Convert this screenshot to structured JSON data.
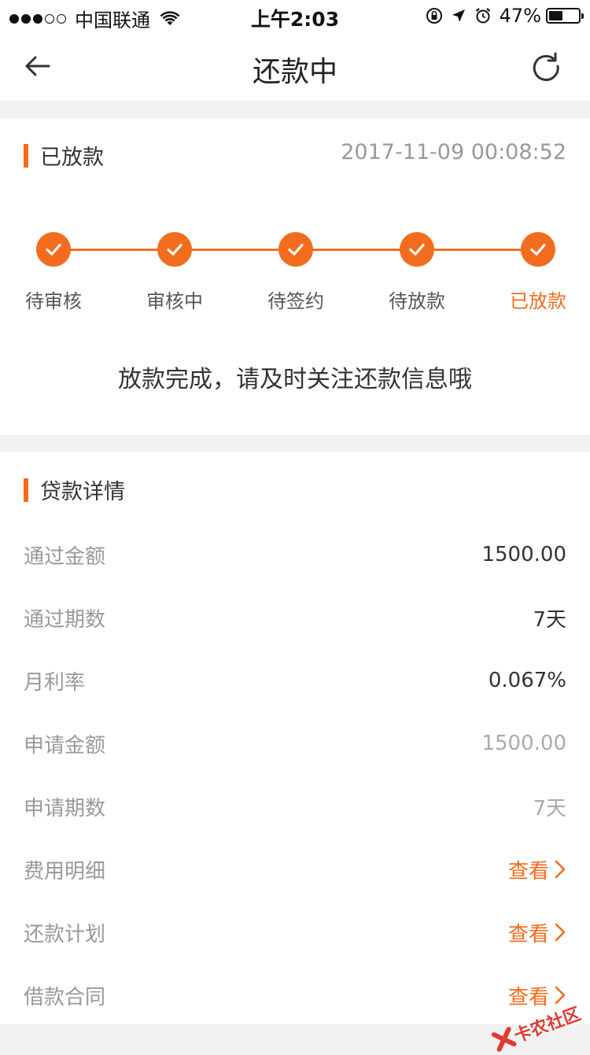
{
  "status_bar": {
    "carrier": "中国联通",
    "time": "上午2:03",
    "battery": "47%",
    "battery_level": 0.47
  },
  "nav": {
    "title": "还款中",
    "back_icon": "arrow-left-icon",
    "refresh_icon": "refresh-icon"
  },
  "status_card": {
    "title": "已放款",
    "timestamp": "2017-11-09 00:08:52",
    "steps": [
      {
        "label": "待审核",
        "active": false
      },
      {
        "label": "审核中",
        "active": false
      },
      {
        "label": "待签约",
        "active": false
      },
      {
        "label": "待放款",
        "active": false
      },
      {
        "label": "已放款",
        "active": true
      }
    ],
    "message": "放款完成，请及时关注还款信息哦"
  },
  "loan_detail": {
    "title": "贷款详情",
    "rows": [
      {
        "label": "通过金额",
        "value": "1500.00"
      },
      {
        "label": "通过期数",
        "value": "7天"
      },
      {
        "label": "月利率",
        "value": "0.067%"
      },
      {
        "label": "申请金额",
        "value": "1500.00"
      },
      {
        "label": "申请期数",
        "value": "7天"
      },
      {
        "label": "费用明细",
        "value": "查看"
      },
      {
        "label": "还款计划",
        "value": "查看"
      },
      {
        "label": "借款合同",
        "value": "查看"
      }
    ]
  },
  "watermark": {
    "text": "卡农社区"
  },
  "colors": {
    "accent": "#f26c1e",
    "muted_text": "#999999",
    "page_bg": "#f2f2f2"
  }
}
